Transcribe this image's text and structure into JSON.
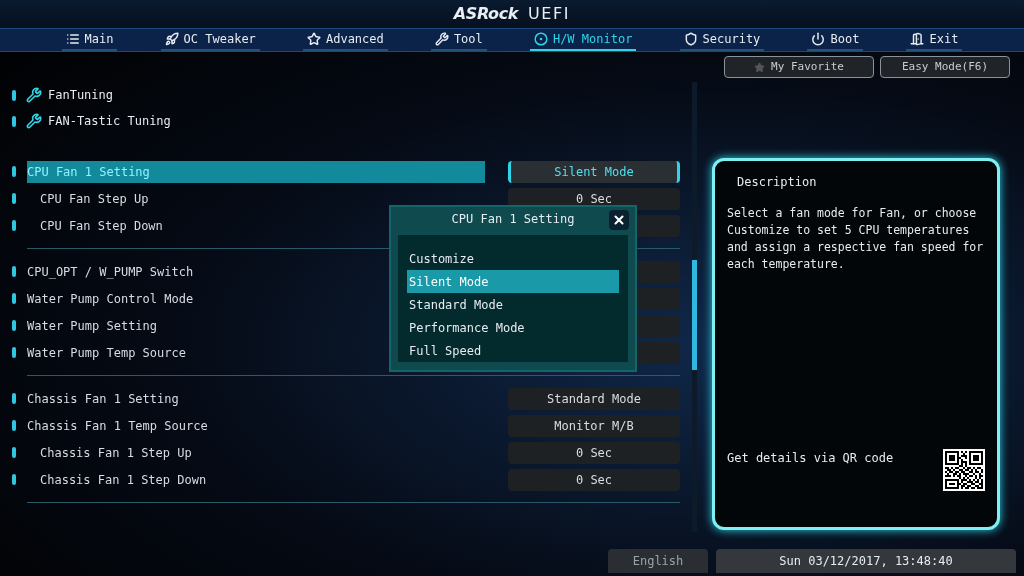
{
  "header": {
    "logo": "ASRock",
    "title": "UEFI"
  },
  "tabs": [
    {
      "label": "Main",
      "selected": false
    },
    {
      "label": "OC Tweaker",
      "selected": false
    },
    {
      "label": "Advanced",
      "selected": false
    },
    {
      "label": "Tool",
      "selected": false
    },
    {
      "label": "H/W Monitor",
      "selected": true
    },
    {
      "label": "Security",
      "selected": false
    },
    {
      "label": "Boot",
      "selected": false
    },
    {
      "label": "Exit",
      "selected": false
    }
  ],
  "shortcuts": [
    {
      "label": "My Favorite",
      "kind": "favorite"
    },
    {
      "label": "Easy Mode(F6)",
      "kind": "plain"
    }
  ],
  "tools": [
    {
      "label": "FanTuning"
    },
    {
      "label": "FAN-Tastic Tuning"
    }
  ],
  "groups": [
    {
      "rows": [
        {
          "label": "CPU Fan 1 Setting",
          "indented": false,
          "selected": true,
          "value": "Silent Mode"
        },
        {
          "label": "CPU Fan Step Up",
          "indented": true,
          "selected": false,
          "value": "0 Sec"
        },
        {
          "label": "CPU Fan Step Down",
          "indented": true,
          "selected": false
        }
      ]
    },
    {
      "rows": [
        {
          "label": "CPU_OPT / W_PUMP Switch",
          "indented": false,
          "selected": false
        },
        {
          "label": "Water Pump Control Mode",
          "indented": false,
          "selected": false
        },
        {
          "label": "Water Pump Setting",
          "indented": false,
          "selected": false
        },
        {
          "label": "Water Pump Temp Source",
          "indented": false,
          "selected": false
        }
      ]
    },
    {
      "rows": [
        {
          "label": "Chassis Fan 1 Setting",
          "indented": false,
          "selected": false,
          "value": "Standard Mode"
        },
        {
          "label": "Chassis Fan 1 Temp Source",
          "indented": false,
          "selected": false,
          "value": "Monitor M/B"
        },
        {
          "label": "Chassis Fan 1 Step Up",
          "indented": true,
          "selected": false,
          "value": "0 Sec"
        },
        {
          "label": "Chassis Fan 1 Step Down",
          "indented": true,
          "selected": false,
          "value": "0 Sec"
        }
      ]
    }
  ],
  "popup": {
    "title": "CPU Fan 1 Setting",
    "options": [
      {
        "label": "Customize",
        "selected": false
      },
      {
        "label": "Silent Mode",
        "selected": true
      },
      {
        "label": "Standard Mode",
        "selected": false
      },
      {
        "label": "Performance Mode",
        "selected": false
      },
      {
        "label": "Full Speed",
        "selected": false
      }
    ]
  },
  "description": {
    "title": "Description",
    "text": "Select a fan mode for Fan, or choose Customize to set 5 CPU temperatures and assign a respective fan speed for each temperature.",
    "qr_label": "Get details via QR code"
  },
  "status_bar": {
    "language": "English",
    "datetime": "Sun 03/12/2017, 13:48:40"
  }
}
